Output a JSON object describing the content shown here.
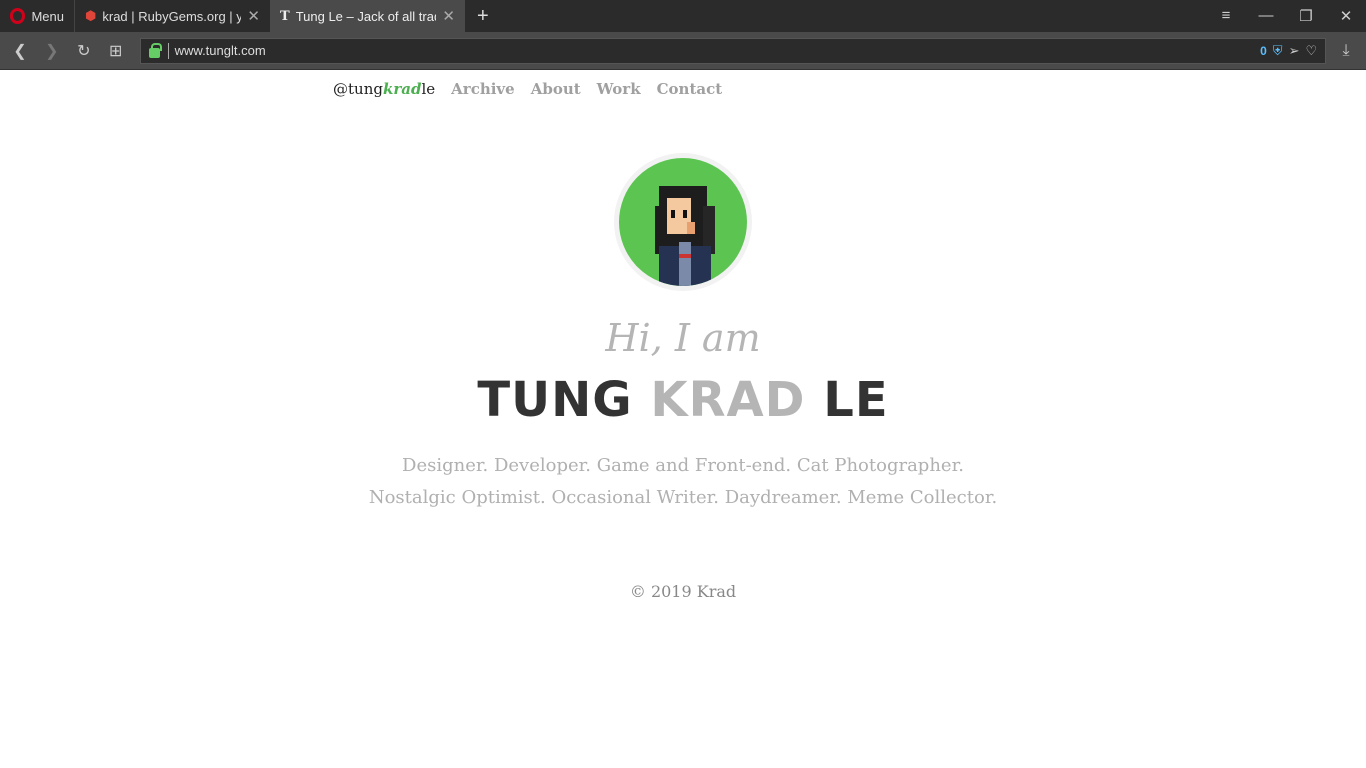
{
  "browser": {
    "menu_label": "Menu",
    "tabs": [
      {
        "title": "krad | RubyGems.org | your"
      },
      {
        "title": "Tung Le – Jack of all trades"
      }
    ],
    "url": "www.tunglt.com",
    "blocker_count": "0"
  },
  "nav": {
    "brand_pre": "@tung",
    "brand_mid": "krad",
    "brand_post": "le",
    "links": [
      "Archive",
      "About",
      "Work",
      "Contact"
    ]
  },
  "hero": {
    "greeting": "Hi, I am",
    "name_first": "TUNG",
    "name_nick": "KRAD",
    "name_last": "LE",
    "tagline_1": "Designer. Developer. Game and Front-end. Cat Photographer.",
    "tagline_2": "Nostalgic Optimist. Occasional Writer. Daydreamer. Meme Collector."
  },
  "footer": {
    "copyright": "© 2019 Krad"
  },
  "colors": {
    "accent": "#4caf50",
    "avatar_bg": "#5cc552"
  }
}
